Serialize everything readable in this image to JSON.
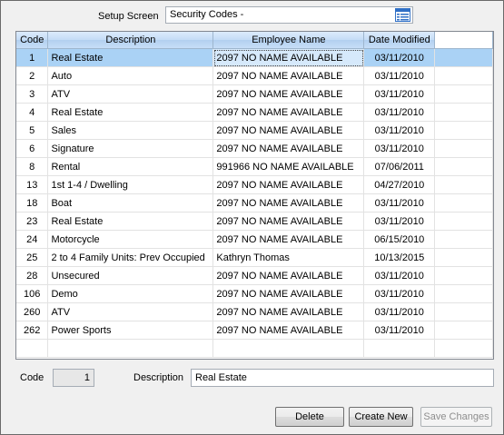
{
  "setup": {
    "label": "Setup Screen",
    "value": "Security Codes -"
  },
  "grid": {
    "columns": [
      "Code",
      "Description",
      "Employee Name",
      "Date Modified"
    ],
    "rows": [
      {
        "code": "1",
        "description": "Real Estate",
        "employee": "2097 NO NAME AVAILABLE",
        "date": "03/11/2010"
      },
      {
        "code": "2",
        "description": "Auto",
        "employee": "2097 NO NAME AVAILABLE",
        "date": "03/11/2010"
      },
      {
        "code": "3",
        "description": "ATV",
        "employee": "2097 NO NAME AVAILABLE",
        "date": "03/11/2010"
      },
      {
        "code": "4",
        "description": "Real Estate",
        "employee": "2097 NO NAME AVAILABLE",
        "date": "03/11/2010"
      },
      {
        "code": "5",
        "description": "Sales",
        "employee": "2097 NO NAME AVAILABLE",
        "date": "03/11/2010"
      },
      {
        "code": "6",
        "description": "Signature",
        "employee": "2097 NO NAME AVAILABLE",
        "date": "03/11/2010"
      },
      {
        "code": "8",
        "description": "Rental",
        "employee": "991966 NO NAME AVAILABLE",
        "date": "07/06/2011"
      },
      {
        "code": "13",
        "description": "1st 1-4 / Dwelling",
        "employee": "2097 NO NAME AVAILABLE",
        "date": "04/27/2010"
      },
      {
        "code": "18",
        "description": "Boat",
        "employee": "2097 NO NAME AVAILABLE",
        "date": "03/11/2010"
      },
      {
        "code": "23",
        "description": "Real Estate",
        "employee": "2097 NO NAME AVAILABLE",
        "date": "03/11/2010"
      },
      {
        "code": "24",
        "description": "Motorcycle",
        "employee": "2097 NO NAME AVAILABLE",
        "date": "06/15/2010"
      },
      {
        "code": "25",
        "description": "2 to 4 Family Units: Prev Occupied",
        "employee": "Kathryn Thomas",
        "date": "10/13/2015"
      },
      {
        "code": "28",
        "description": "Unsecured",
        "employee": "2097 NO NAME AVAILABLE",
        "date": "03/11/2010"
      },
      {
        "code": "106",
        "description": "Demo",
        "employee": "2097 NO NAME AVAILABLE",
        "date": "03/11/2010"
      },
      {
        "code": "260",
        "description": "ATV",
        "employee": "2097 NO NAME AVAILABLE",
        "date": "03/11/2010"
      },
      {
        "code": "262",
        "description": "Power Sports",
        "employee": "2097 NO NAME AVAILABLE",
        "date": "03/11/2010"
      }
    ]
  },
  "detail": {
    "code_label": "Code",
    "code_value": "1",
    "description_label": "Description",
    "description_value": "Real Estate"
  },
  "buttons": {
    "delete": "Delete",
    "create_new": "Create New",
    "save_changes": "Save Changes"
  },
  "icons": {
    "list_button": "list-view-icon"
  }
}
